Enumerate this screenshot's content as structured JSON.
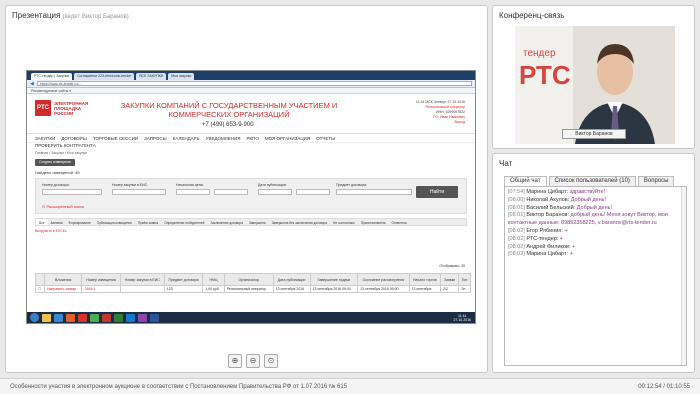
{
  "presentation": {
    "title": "Презентация",
    "subtitle": "(ведет Виктор Баранов)",
    "browser": {
      "tabs": [
        "РТС-тендер | Закупки",
        "Соглашение 223-electronic-tender",
        "ВСЕ ЗАКУПКИ",
        "Мои закупки"
      ],
      "url": "https://www.rts-tender.ru/...",
      "favorites": "Рекомендуемые сайты ▾"
    },
    "site": {
      "logo": "РТС",
      "logo_caption": [
        "ЭЛЕКТРОННАЯ",
        "ПЛОЩАДКА",
        "РОССИИ"
      ],
      "title": "ЗАКУПКИ КОМПАНИЙ С ГОСУДАРСТВЕННЫМ УЧАСТИЕМ И КОММЕРЧЕСКИХ ОРГАНИЗАЦИЙ",
      "phone": "+7 (499) 653-9-900",
      "user_time": "11:14 МСК Четверг 27.10.2016",
      "user_org": "Региональный оператор",
      "user_inn": "ИНН: 9299007822",
      "user_name": "РО: Иван Иванович",
      "user_exit": "Выход",
      "nav": [
        "ЗАКУПКИ",
        "ДОГОВОРЫ",
        "ТОРГОВЫЕ СЕССИИ",
        "ЗАПРОСЫ",
        "КАЛЕНДАРЬ",
        "УВЕДОМЛЕНИЯ",
        "РКПО",
        "МОЯ ОРГАНИЗАЦИЯ",
        "ОТЧЕТЫ"
      ],
      "nav2": "ПРОВЕРИТЬ КОНТРАГЕНТА",
      "breadcrumb": "Главная / Закупки / Мои закупки",
      "create_button": "Создать извещение",
      "found": "Найдено извещений: 49",
      "filters": [
        "Номер договора:",
        "Номер закупки в ЕИС:",
        "Начальная цена:",
        "Дата публикации:",
        "Предмет договора:"
      ],
      "find_button": "Найти",
      "advanced": "Расширенный поиск",
      "status_tabs": [
        "Все",
        "Активна",
        "Формирование",
        "Публикация извещения",
        "Приём заявок",
        "Определение победителей",
        "Заключение договора",
        "Завершена",
        "Завершена без заключения договора",
        "Не состоялась",
        "Приостановлена",
        "Отменена"
      ],
      "excel": "Выгрузить в EXCEL",
      "pager": "Отображать: 20",
      "table_headers": [
        "",
        "Вложения",
        "Номер извещения",
        "Номер закупки в ЕИС",
        "Предмет договора",
        "НМЦ",
        "Организатор",
        "Дата публикации",
        "Завершение подачи",
        "Окончание рассмотрения",
        "Начало торгов",
        "Заявки",
        "Тип"
      ],
      "table_row": [
        "",
        "Направить заявку",
        "2460/1",
        "",
        "123",
        "1,00 руб.",
        "Региональный оператор",
        "13 сентября 2016",
        "13 сентября 2016 09:00",
        "13 сентября 2016 09:00",
        "13 сентября",
        "2/2",
        "Эл"
      ]
    },
    "taskbar_clock": [
      "11:14",
      "27.10.2016"
    ],
    "zoom_buttons": [
      "+",
      "-",
      "□"
    ]
  },
  "conference": {
    "title": "Конференц-связь",
    "speaker": "Виктор Баранов",
    "backdrop_text": "тендер",
    "backdrop_logo": "РТС"
  },
  "chat": {
    "title": "Чат",
    "tabs": [
      "Общий чат",
      "Список пользователей (10)",
      "Вопросы"
    ],
    "messages": [
      {
        "time": "[07:54]",
        "author": "Марина Цибарт:",
        "text": "здравствуйте!"
      },
      {
        "time": "[08:00]",
        "author": "Николай Акулов:",
        "text": "Добрый день!"
      },
      {
        "time": "[08:01]",
        "author": "Василий Бельский:",
        "text": "Добрый день!"
      },
      {
        "time": "[08:01]",
        "author": "Виктор Баранов:",
        "text": "добрый день! Меня зовут Виктор, мои контактные данные: 89852358225, v.baranov@rts-tender.ru"
      },
      {
        "time": "[08:02]",
        "author": "Егор Рябинин:",
        "text": "+"
      },
      {
        "time": "[08:02]",
        "author": "РТС-тендер:",
        "text": "+"
      },
      {
        "time": "[08:02]",
        "author": "Андрей Филиков:",
        "text": "+"
      },
      {
        "time": "[08:02]",
        "author": "Марина Цибарт:",
        "text": "+"
      }
    ]
  },
  "bottombar": {
    "document": "Особенности участия в электронном аукционе в соответствии с Постановлением Правительства РФ от 1.07.2016 № 615",
    "time": "00:12:54 / 01:10:55"
  }
}
